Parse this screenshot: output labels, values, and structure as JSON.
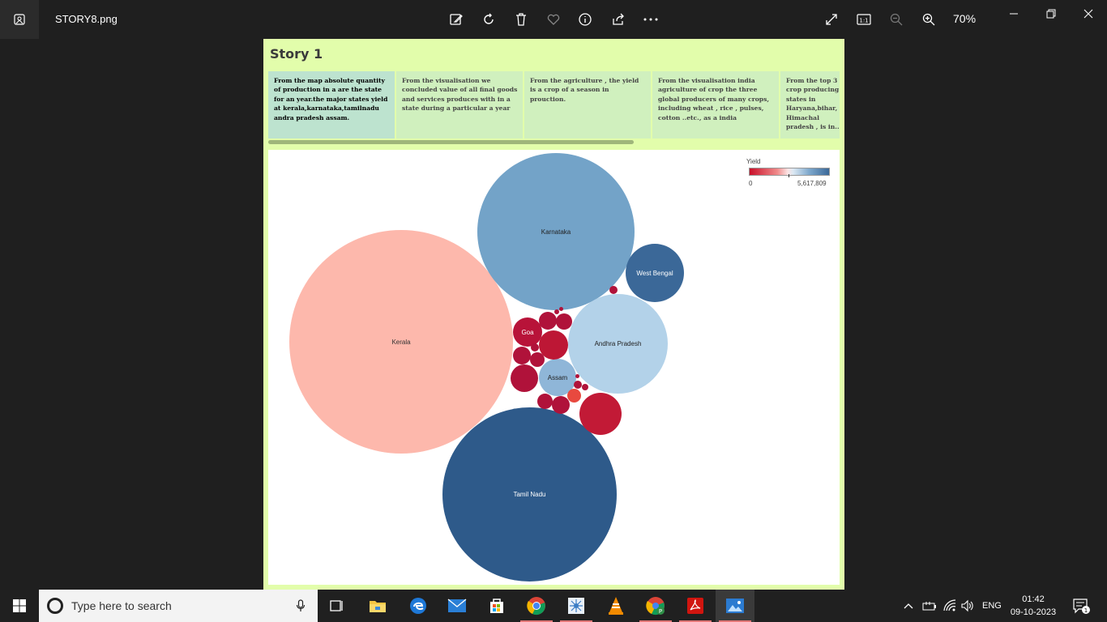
{
  "titlebar": {
    "filename": "STORY8.png",
    "zoom": "70%",
    "icons": [
      "edit-icon",
      "rotate-icon",
      "delete-icon",
      "heart-icon",
      "info-icon",
      "share-icon",
      "more-icon",
      "fullscreen-icon",
      "actual-size-icon",
      "zoom-out-icon",
      "zoom-in-icon"
    ]
  },
  "story": {
    "title": "Story 1",
    "points": [
      " From the map absolute quantity of production in a are the state for an year.the major states yield at kerala,karnataka,tamilnadu andra pradesh assam.",
      " From the visualisation we concluded value of all final goods and services produces with in a state during a particular a year",
      "From  the  agriculture , the yield is a crop of a season in prouction.",
      "From the visualisation india agriculture of crop the three global producers of many crops, including wheat , rice , pulses, cotton ..etc., as a india",
      "From  the top  3 crop producing states in Haryana,bihar, Himachal pradesh ,  is in.."
    ]
  },
  "legend": {
    "title": "Yield",
    "min": "0",
    "max": "5,617,809",
    "colors": {
      "low": "#c9102a",
      "mid": "#fbe4e4",
      "high": "#3b6898"
    }
  },
  "bubbles": {
    "kerala": "Kerala",
    "karnataka": "Karnataka",
    "west_bengal": "West Bengal",
    "andhra_pradesh": "Andhra Pradesh",
    "goa": "Goa",
    "assam": "Assam",
    "tamil_nadu": "Tamil Nadu"
  },
  "taskbar": {
    "search_placeholder": "Type here to search",
    "language": "ENG",
    "time": "01:42",
    "date": "09-10-2023",
    "notifications": "1"
  }
}
